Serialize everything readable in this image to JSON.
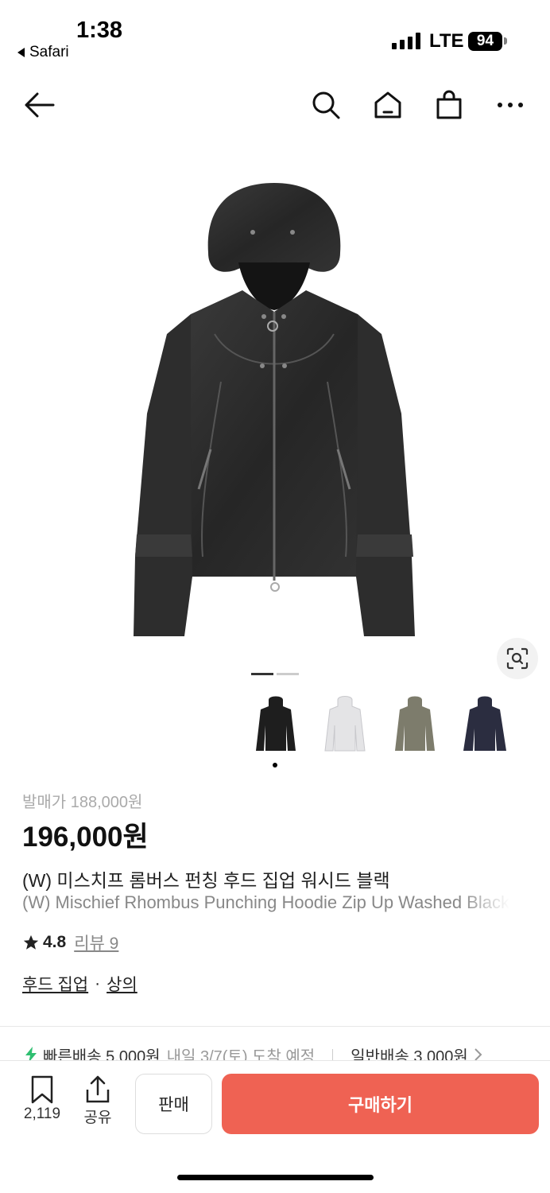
{
  "status_bar": {
    "time": "1:38",
    "back_app": "Safari",
    "network": "LTE",
    "battery": "94"
  },
  "nav": {
    "icons": [
      "back-arrow-icon",
      "search-icon",
      "home-icon",
      "shopping-bag-icon",
      "more-icon"
    ]
  },
  "product": {
    "image_count": 2,
    "current_image": 1,
    "variants": [
      "black",
      "white",
      "khaki",
      "navy"
    ],
    "selected_variant": 0,
    "release_price": "발매가 188,000원",
    "price": "196,000원",
    "title_ko": "(W) 미스치프 롬버스 펀칭 후드 집업 워시드 블랙",
    "title_en": "(W) Mischief Rhombus Punching Hoodie Zip Up Washed Black",
    "rating": "4.8",
    "review_label": "리뷰 9",
    "category_1": "후드 집업",
    "category_sep": "·",
    "category_2": "상의"
  },
  "shipping": {
    "fast_label": "빠른배송 5,000원",
    "fast_eta": "내일 3/7(토) 도착 예정",
    "normal_label": "일반배송 3,000원"
  },
  "bottom_bar": {
    "bookmark_count": "2,119",
    "share_label": "공유",
    "sell_label": "판매",
    "buy_label": "구매하기"
  },
  "colors": {
    "accent": "#ef6253",
    "fast_ship": "#2fbf71"
  }
}
